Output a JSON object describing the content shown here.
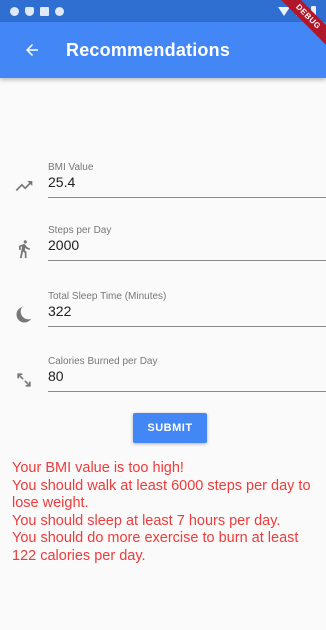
{
  "app_bar": {
    "title": "Recommendations"
  },
  "debug_banner": "DEBUG",
  "fields": [
    {
      "label": "BMI Value",
      "value": "25.4",
      "icon": "trending-up-icon"
    },
    {
      "label": "Steps per Day",
      "value": "2000",
      "icon": "walk-icon"
    },
    {
      "label": "Total Sleep Time (Minutes)",
      "value": "322",
      "icon": "moon-icon"
    },
    {
      "label": "Calories Burned per Day",
      "value": "80",
      "icon": "expand-diagonal-icon"
    }
  ],
  "submit_label": "SUBMIT",
  "result_lines": [
    "Your BMI value is too high!",
    "You should walk at least 6000 steps per day to lose weight.",
    "You should sleep at least 7 hours per day.",
    "You should do more exercise to burn at least 122 calories per day."
  ],
  "colors": {
    "primary": "#4287f5",
    "status_bar": "#2f6fd1",
    "error_text": "#ef3b3b",
    "debug": "#b0172a"
  }
}
